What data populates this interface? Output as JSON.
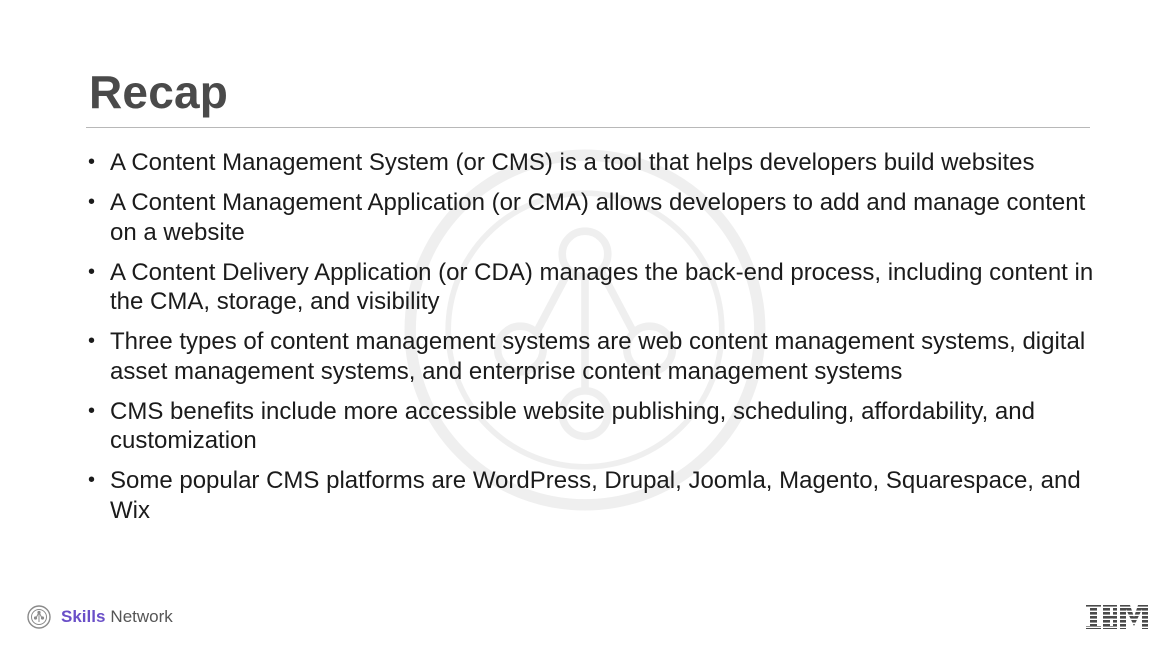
{
  "slide": {
    "title": "Recap",
    "bullets": [
      "A Content Management System (or CMS) is a tool that helps developers build websites",
      "A Content Management Application (or CMA) allows developers to add and manage content on a website",
      "A Content Delivery Application (or CDA) manages the back-end process, including content in the CMA, storage, and visibility",
      "Three types of content management systems are web content management systems, digital asset management systems, and enterprise content management systems",
      "CMS benefits include more accessible website publishing, scheduling, affordability, and customization",
      "Some popular CMS platforms are WordPress, Drupal, Joomla, Magento, Squarespace, and Wix"
    ],
    "bullet_symbol": "•"
  },
  "footer": {
    "brand_strong": "Skills",
    "brand_light": "Network",
    "brand_icon": "skills-network-logo-icon",
    "corporate_logo": "IBM"
  },
  "colors": {
    "title": "#4a4a4a",
    "rule": "#b8b8b8",
    "brand_accent": "#6a4fc8",
    "ibm_logo": "#4a4a4a"
  }
}
